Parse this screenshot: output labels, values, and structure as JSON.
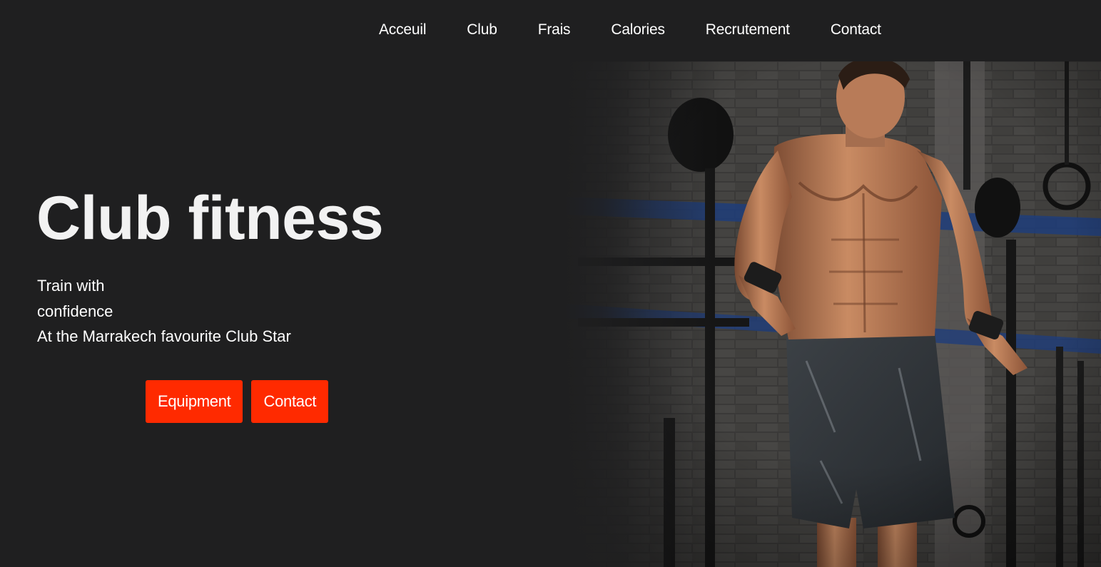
{
  "nav": {
    "items": [
      {
        "label": "Acceuil"
      },
      {
        "label": "Club"
      },
      {
        "label": "Frais"
      },
      {
        "label": "Calories"
      },
      {
        "label": "Recrutement"
      },
      {
        "label": "Contact"
      }
    ]
  },
  "hero": {
    "title": "Club fitness",
    "subtitle_lines": [
      "Train with",
      "confidence",
      "At the Marrakech favourite Club Star"
    ],
    "buttons": {
      "equipment": "Equipment",
      "contact": "Contact"
    },
    "image": {
      "subject": "athlete-in-gym"
    }
  },
  "colors": {
    "background": "#1f1f20",
    "accent": "#ff2a00",
    "text": "#ffffff"
  }
}
